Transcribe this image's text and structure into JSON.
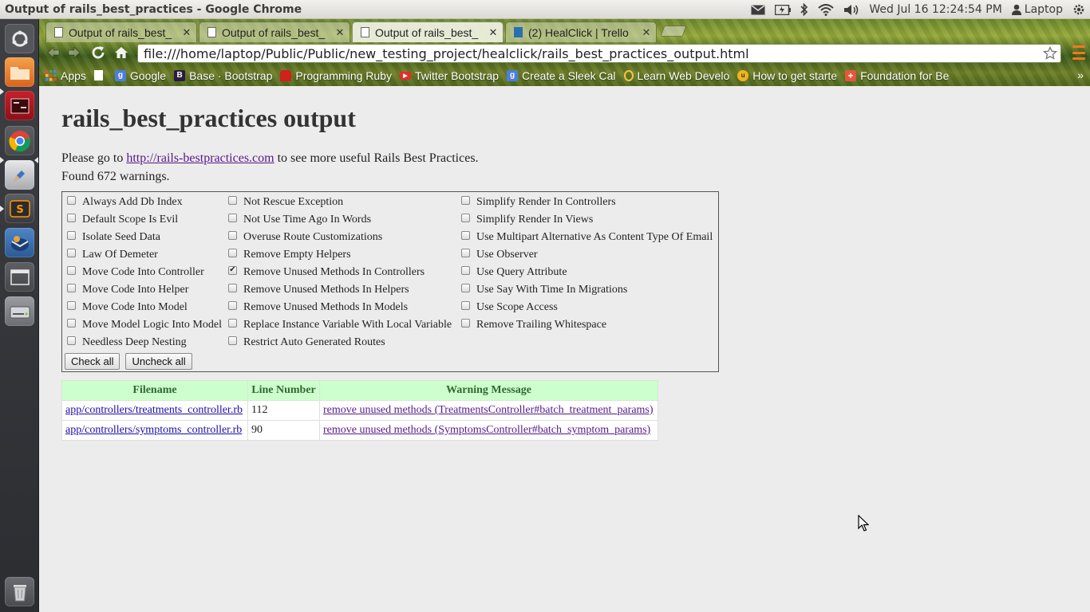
{
  "window": {
    "title": "Output of rails_best_practices - Google Chrome"
  },
  "indicators": {
    "datetime": "Wed Jul 16 12:24:54 PM",
    "user": "Laptop"
  },
  "tabs": [
    {
      "label": "Output of rails_best_",
      "active": false
    },
    {
      "label": "Output of rails_best_",
      "active": false
    },
    {
      "label": "Output of rails_best_",
      "active": true
    },
    {
      "label": "(2) HealClick | Trello",
      "active": false
    }
  ],
  "address_bar": {
    "url": "file:///home/laptop/Public/Public/new_testing_project/healclick/rails_best_practices_output.html"
  },
  "bookmarks": [
    {
      "label": "Apps",
      "icon": "apps-grid-icon"
    },
    {
      "label": "",
      "icon": "page-icon"
    },
    {
      "label": "Google",
      "icon": "google-icon"
    },
    {
      "label": "Base · Bootstrap",
      "icon": "bootstrap-icon"
    },
    {
      "label": "Programming Ruby",
      "icon": "ruby-icon"
    },
    {
      "label": "Twitter Bootstrap",
      "icon": "youtube-icon"
    },
    {
      "label": "Create a Sleek Cal",
      "icon": "google-icon"
    },
    {
      "label": "Learn Web Develo",
      "icon": "ring-icon"
    },
    {
      "label": "How to get starte",
      "icon": "udemy-icon"
    },
    {
      "label": "Foundation for Be",
      "icon": "foundation-icon"
    }
  ],
  "page": {
    "title": "rails_best_practices output",
    "intro_prefix": "Please go to ",
    "intro_link": "http://rails-bestpractices.com",
    "intro_suffix": " to see more useful Rails Best Practices.",
    "found_text": "Found 672 warnings.",
    "filters": {
      "col1": [
        {
          "label": "Always Add Db Index",
          "checked": false
        },
        {
          "label": "Default Scope Is Evil",
          "checked": false
        },
        {
          "label": "Isolate Seed Data",
          "checked": false
        },
        {
          "label": "Law Of Demeter",
          "checked": false
        },
        {
          "label": "Move Code Into Controller",
          "checked": false
        },
        {
          "label": "Move Code Into Helper",
          "checked": false
        },
        {
          "label": "Move Code Into Model",
          "checked": false
        },
        {
          "label": "Move Model Logic Into Model",
          "checked": false
        },
        {
          "label": "Needless Deep Nesting",
          "checked": false
        }
      ],
      "col2": [
        {
          "label": "Not Rescue Exception",
          "checked": false
        },
        {
          "label": "Not Use Time Ago In Words",
          "checked": false
        },
        {
          "label": "Overuse Route Customizations",
          "checked": false
        },
        {
          "label": "Remove Empty Helpers",
          "checked": false
        },
        {
          "label": "Remove Unused Methods In Controllers",
          "checked": true
        },
        {
          "label": "Remove Unused Methods In Helpers",
          "checked": false
        },
        {
          "label": "Remove Unused Methods In Models",
          "checked": false
        },
        {
          "label": "Replace Instance Variable With Local Variable",
          "checked": false
        },
        {
          "label": "Restrict Auto Generated Routes",
          "checked": false
        }
      ],
      "col3": [
        {
          "label": "Simplify Render In Controllers",
          "checked": false
        },
        {
          "label": "Simplify Render In Views",
          "checked": false
        },
        {
          "label": "Use Multipart Alternative As Content Type Of Email",
          "checked": false
        },
        {
          "label": "Use Observer",
          "checked": false
        },
        {
          "label": "Use Query Attribute",
          "checked": false
        },
        {
          "label": "Use Say With Time In Migrations",
          "checked": false
        },
        {
          "label": "Use Scope Access",
          "checked": false
        },
        {
          "label": "Remove Trailing Whitespace",
          "checked": false
        }
      ]
    },
    "buttons": {
      "check_all": "Check all",
      "uncheck_all": "Uncheck all"
    },
    "table": {
      "headers": [
        "Filename",
        "Line Number",
        "Warning Message"
      ],
      "rows": [
        {
          "filename": "app/controllers/treatments_controller.rb",
          "line": "112",
          "message": "remove unused methods (TreatmentsController#batch_treatment_params)"
        },
        {
          "filename": "app/controllers/symptoms_controller.rb",
          "line": "90",
          "message": "remove unused methods (SymptomsController#batch_symptom_params)"
        }
      ]
    }
  },
  "colors": {
    "table_header_bg": "#ccffcc",
    "table_header_text": "#336633",
    "visited_link": "#551a8b",
    "link": "#1a0dab"
  }
}
